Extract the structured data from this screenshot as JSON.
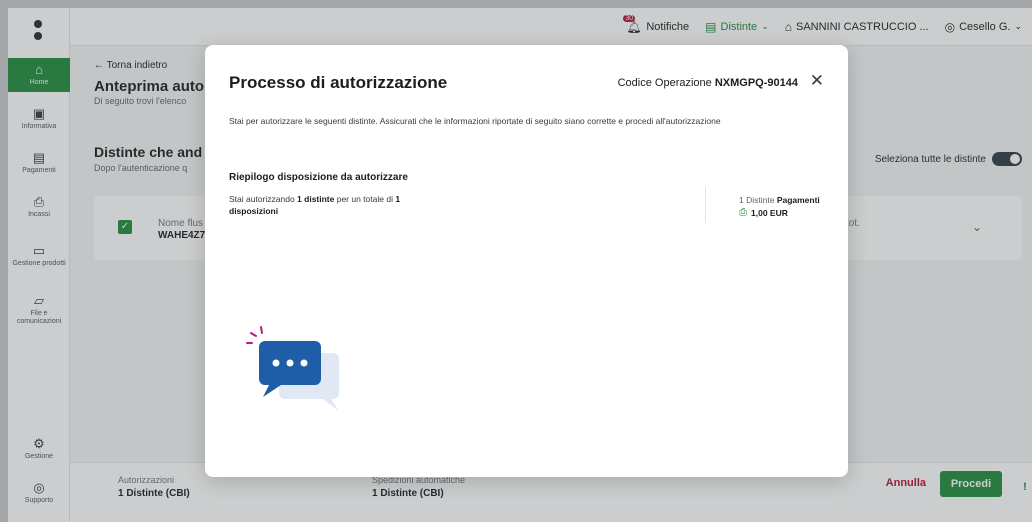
{
  "topbar": {
    "notification_count": "30",
    "notifications_label": "Notifiche",
    "distinte_label": "Distinte",
    "company_label": "SANNINI CASTRUCCIO ...",
    "user_label": "Cesello G."
  },
  "sidebar": {
    "items": [
      {
        "label": "Home",
        "icon": "home-icon"
      },
      {
        "label": "Informativa",
        "icon": "info-icon"
      },
      {
        "label": "Pagamenti",
        "icon": "payments-icon"
      },
      {
        "label": "Incassi",
        "icon": "collections-icon"
      },
      {
        "label": "Gestione prodotti",
        "icon": "products-icon"
      },
      {
        "label": "File e comunicazioni",
        "icon": "folder-icon"
      }
    ],
    "bottom_items": [
      {
        "label": "Gestione",
        "icon": "gear-icon"
      },
      {
        "label": "Supporto",
        "icon": "support-icon"
      }
    ]
  },
  "page": {
    "back_label": "Torna indietro",
    "title": "Anteprima autor",
    "subtitle": "Di seguito trovi l'elenco",
    "section_title": "Distinte che and",
    "section_subtitle": "Dopo l'autenticazione q",
    "select_all_label": "Seleziona tutte le distinte",
    "card": {
      "label": "Nome flus",
      "value": "WAHE4Z7",
      "tot_label": "tot."
    }
  },
  "footer": {
    "auth_label": "Autorizzazioni",
    "auth_value": "1 Distinte (CBI)",
    "ship_label": "Spedizioni automatiche",
    "ship_value": "1 Distinte (CBI)",
    "cancel_label": "Annulla",
    "proceed_label": "Procedi"
  },
  "modal": {
    "title": "Processo di autorizzazione",
    "code_label": "Codice Operazione",
    "code_value": "NXMGPQ-90144",
    "description": "Stai per autorizzare le seguenti distinte. Assicurati che le informazioni riportate di seguito siano corrette e procedi all'autorizzazione",
    "summary_title": "Riepilogo disposizione da autorizzare",
    "summary_prefix": "Stai autorizzando ",
    "summary_count": "1 distinte",
    "summary_middle": " per un totale di ",
    "summary_total": "1 disposizioni",
    "right_count": "1 Distinte",
    "right_type": "Pagamenti",
    "right_amount": "1,00 EUR"
  },
  "colors": {
    "brand_green": "#1f8b3b",
    "danger_red": "#b3123a",
    "illustration_blue": "#1e5ea8"
  }
}
